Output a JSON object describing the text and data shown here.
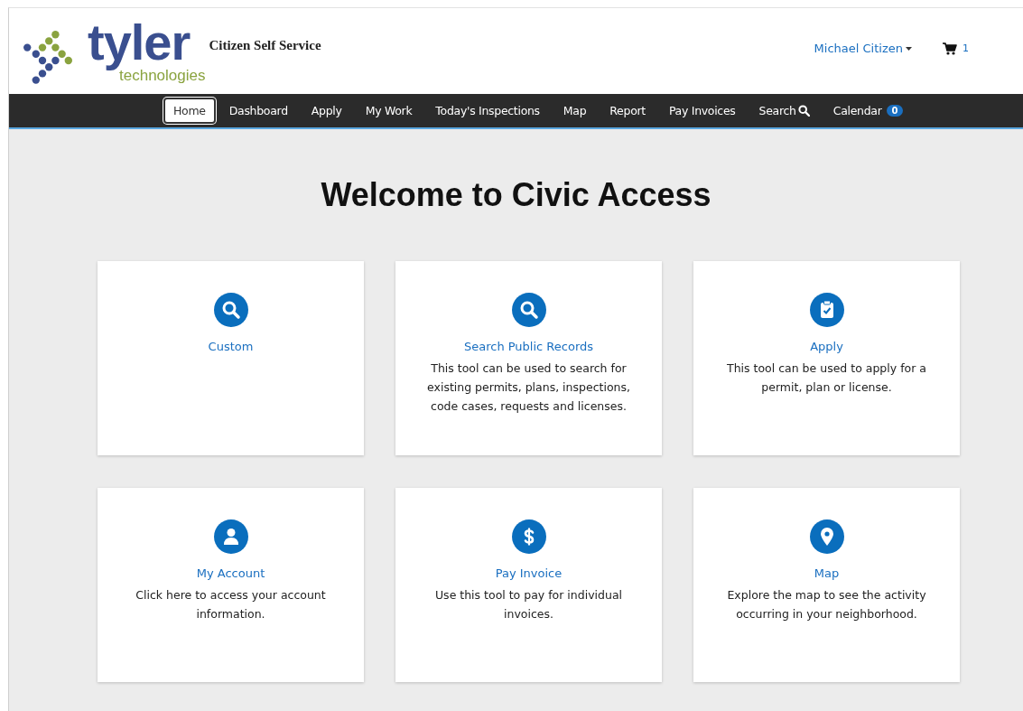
{
  "header": {
    "logo": {
      "word": "tyler",
      "subword": "technologies"
    },
    "app_title": "Citizen Self Service",
    "user_menu": {
      "label": "Michael Citizen"
    },
    "cart": {
      "count": "1"
    }
  },
  "nav": [
    {
      "label": "Home",
      "selected": true,
      "kind": "plain"
    },
    {
      "label": "Dashboard",
      "selected": false,
      "kind": "plain"
    },
    {
      "label": "Apply",
      "selected": false,
      "kind": "plain"
    },
    {
      "label": "My Work",
      "selected": false,
      "kind": "plain"
    },
    {
      "label": "Today's Inspections",
      "selected": false,
      "kind": "plain"
    },
    {
      "label": "Map",
      "selected": false,
      "kind": "plain"
    },
    {
      "label": "Report",
      "selected": false,
      "kind": "plain"
    },
    {
      "label": "Pay Invoices",
      "selected": false,
      "kind": "plain"
    },
    {
      "label": "Search",
      "selected": false,
      "kind": "search"
    },
    {
      "label": "Calendar",
      "selected": false,
      "kind": "plain",
      "badge": "0"
    }
  ],
  "heading": "Welcome to Civic Access",
  "cards": [
    {
      "kind": "search",
      "title": "Custom"
    },
    {
      "kind": "search",
      "title": "Search Public Records",
      "description": "This tool can be used to search for existing permits, plans, inspections, code cases, requests and licenses."
    },
    {
      "kind": "apply",
      "title": "Apply",
      "description": "This tool can be used to apply for a permit, plan or license."
    },
    {
      "kind": "account",
      "title": "My Account",
      "description": "Click here to access your account information."
    },
    {
      "kind": "payment",
      "title": "Pay Invoice",
      "description": "Use this tool to pay for individual invoices."
    },
    {
      "kind": "map",
      "title": "Map",
      "description": "Explore the map to see the activity occurring in your neighborhood."
    }
  ]
}
